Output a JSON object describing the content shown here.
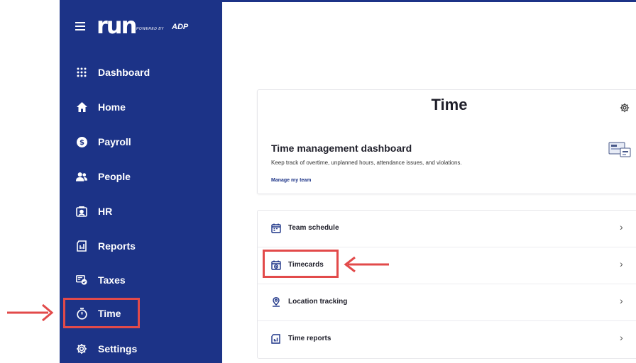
{
  "brand": {
    "logo_text": "run",
    "powered_by": "POWERED BY",
    "adp": "ADP"
  },
  "sidebar": {
    "items": [
      {
        "label": "Dashboard",
        "icon": "grid-icon"
      },
      {
        "label": "Home",
        "icon": "home-icon"
      },
      {
        "label": "Payroll",
        "icon": "dollar-icon"
      },
      {
        "label": "People",
        "icon": "people-icon"
      },
      {
        "label": "HR",
        "icon": "hr-icon"
      },
      {
        "label": "Reports",
        "icon": "reports-icon"
      },
      {
        "label": "Taxes",
        "icon": "taxes-icon"
      },
      {
        "label": "Time",
        "icon": "stopwatch-icon"
      },
      {
        "label": "Settings",
        "icon": "gear-icon"
      }
    ],
    "active": "Time"
  },
  "main": {
    "title": "Time",
    "dashboard": {
      "title": "Time management dashboard",
      "description": "Keep track of overtime, unplanned hours, attendance issues, and violations.",
      "link": "Manage my team"
    },
    "list": [
      {
        "label": "Team schedule",
        "icon": "calendar-icon"
      },
      {
        "label": "Timecards",
        "icon": "timecard-icon"
      },
      {
        "label": "Location tracking",
        "icon": "location-pin-icon"
      },
      {
        "label": "Time reports",
        "icon": "report-icon"
      }
    ]
  },
  "colors": {
    "sidebar_bg": "#1c3387",
    "highlight": "#e24a4a"
  }
}
